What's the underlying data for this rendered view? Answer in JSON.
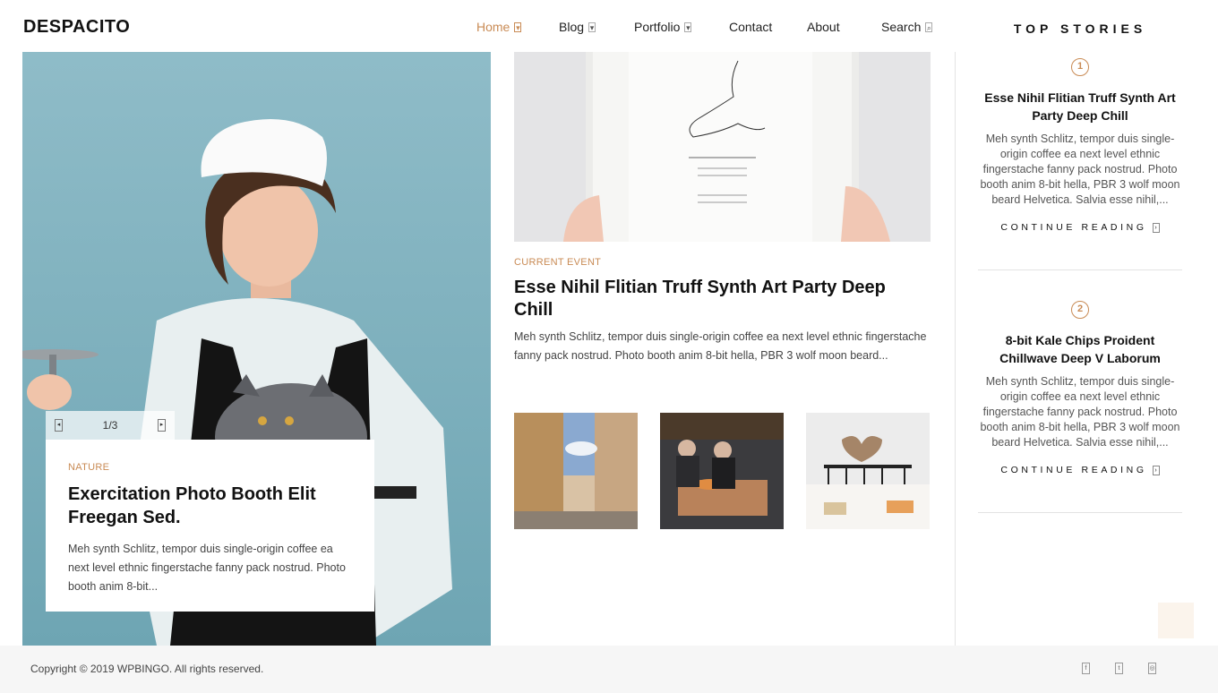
{
  "header": {
    "logo": "DESPACITO",
    "nav": [
      {
        "label": "Home",
        "icon": "chevron-down-icon"
      },
      {
        "label": "Blog",
        "icon": "chevron-down-icon"
      },
      {
        "label": "Portfolio",
        "icon": "chevron-down-icon"
      },
      {
        "label": "Contact"
      },
      {
        "label": "About"
      },
      {
        "label": "Search",
        "icon": "search-icon"
      }
    ]
  },
  "feature": {
    "slider_counter": "1/3",
    "category": "NATURE",
    "title": "Exercitation Photo Booth Elit Freegan Sed.",
    "excerpt": "Meh synth Schlitz, tempor duis single-origin coffee ea next level ethnic fingerstache fanny pack nostrud. Photo booth anim 8-bit..."
  },
  "main_post": {
    "category": "CURRENT EVENT",
    "title": "Esse Nihil Flitian Truff Synth Art Party Deep Chill",
    "excerpt": "Meh synth Schlitz, tempor duis single-origin coffee ea next level ethnic fingerstache fanny pack nostrud. Photo booth anim 8-bit hella, PBR 3 wolf moon beard..."
  },
  "sidebar": {
    "heading": "TOP STORIES",
    "stories": [
      {
        "number": "1",
        "title": "Esse Nihil Flitian Truff Synth Art Party Deep Chill",
        "excerpt": "Meh synth Schlitz, tempor duis single-origin coffee ea next level ethnic fingerstache fanny pack nostrud. Photo booth anim 8-bit hella, PBR 3 wolf moon beard Helvetica. Salvia esse nihil,...",
        "link": "CONTINUE READING"
      },
      {
        "number": "2",
        "title": "8-bit Kale Chips Proident Chillwave Deep V Laborum",
        "excerpt": "Meh synth Schlitz, tempor duis single-origin coffee ea next level ethnic fingerstache fanny pack nostrud. Photo booth anim 8-bit hella, PBR 3 wolf moon beard Helvetica. Salvia esse nihil,...",
        "link": "CONTINUE READING"
      }
    ]
  },
  "footer": {
    "copyright": "Copyright © 2019 WPBINGO. All rights reserved."
  },
  "colors": {
    "accent": "#c98b55",
    "feature_bg": "#7fb3c0",
    "footer_bg": "#f6f6f6"
  }
}
